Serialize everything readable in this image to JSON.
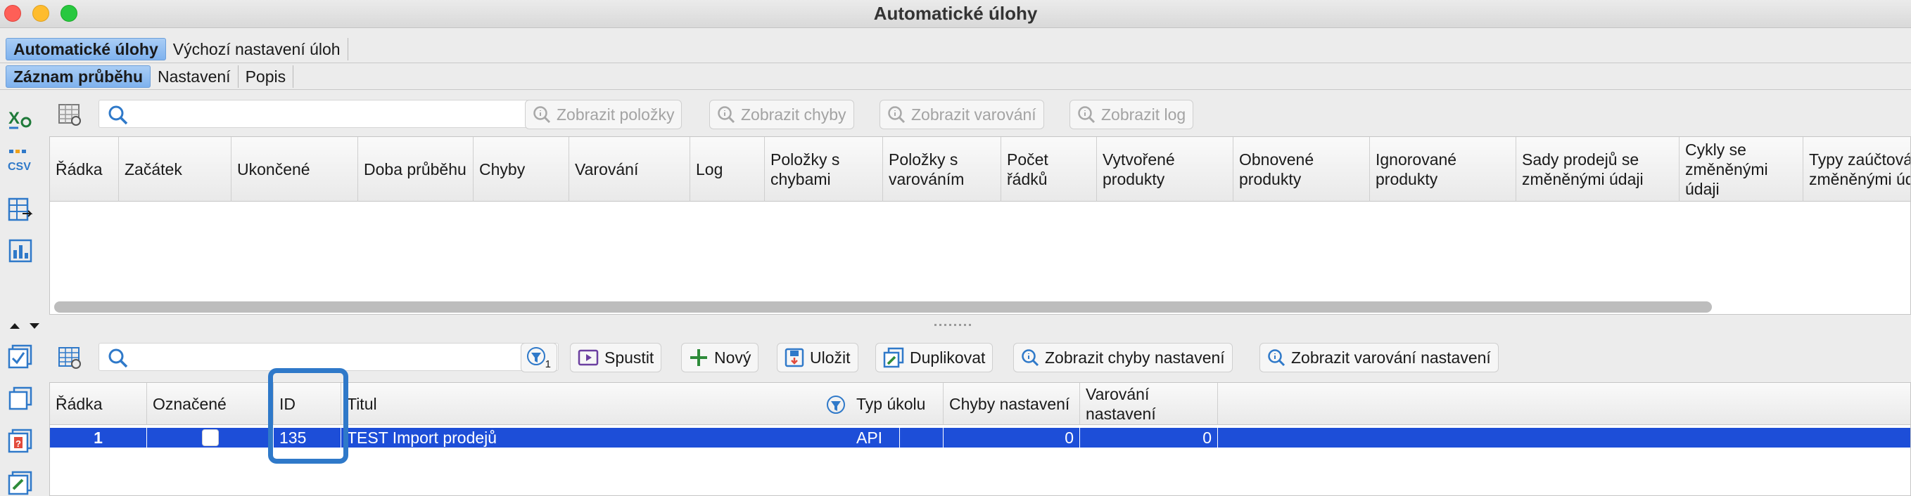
{
  "window": {
    "title": "Automatické úlohy"
  },
  "tabs_main": [
    {
      "label": "Automatické úlohy",
      "active": true
    },
    {
      "label": "Výchozí nastavení úloh",
      "active": false
    }
  ],
  "tabs_sub": [
    {
      "label": "Záznam průběhu",
      "active": true
    },
    {
      "label": "Nastavení",
      "active": false
    },
    {
      "label": "Popis",
      "active": false
    }
  ],
  "top_panel": {
    "search": {
      "value": "",
      "placeholder": ""
    },
    "buttons": {
      "show_items": "Zobrazit položky",
      "show_errors": "Zobrazit chyby",
      "show_warnings": "Zobrazit varování",
      "show_log": "Zobrazit log"
    },
    "columns": [
      "Řádka",
      "Začátek",
      "Ukončené",
      "Doba průběhu",
      "Chyby",
      "Varování",
      "Log",
      "Položky s chybami",
      "Položky s varováním",
      "Počet řádků",
      "Vytvořené produkty",
      "Obnovené produkty",
      "Ignorované produkty",
      "Sady prodejů se změněnými údaji",
      "Cykly se změněnými údaji",
      "Typy zaúčtování se změněnými údaji"
    ]
  },
  "bottom_panel": {
    "search": {
      "value": "",
      "placeholder": ""
    },
    "filter_badge": "1",
    "buttons": {
      "run": "Spustit",
      "new": "Nový",
      "save": "Uložit",
      "duplicate": "Duplikovat",
      "show_setting_errors": "Zobrazit chyby nastavení",
      "show_setting_warnings": "Zobrazit varování nastavení"
    },
    "columns": [
      "Řádka",
      "Označené",
      "ID",
      "Titul",
      "Typ úkolu",
      "Chyby nastavení",
      "Varování nastavení"
    ],
    "rows": [
      {
        "row": "1",
        "checked": false,
        "id": "135",
        "title": "TEST Import prodejů",
        "type": "API",
        "errors": "0",
        "warnings": "0"
      }
    ]
  },
  "colors": {
    "selection": "#1d4ed8",
    "highlight_box": "#2f79c9",
    "active_tab": "#8fbdf1"
  }
}
